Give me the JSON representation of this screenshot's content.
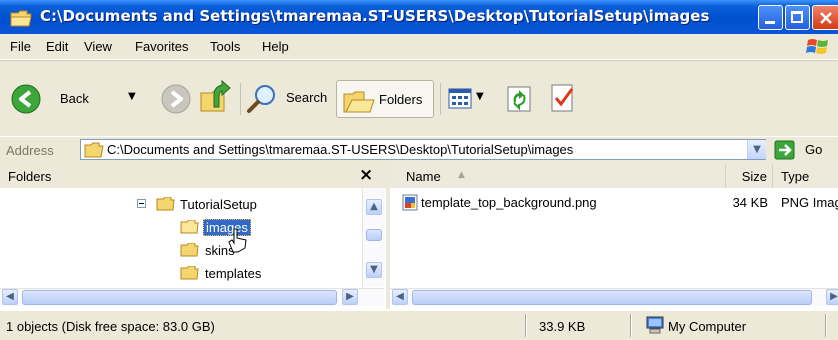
{
  "window": {
    "title": "C:\\Documents and Settings\\tmaremaa.ST-USERS\\Desktop\\TutorialSetup\\images"
  },
  "menu": {
    "items": [
      "File",
      "Edit",
      "View",
      "Favorites",
      "Tools",
      "Help"
    ]
  },
  "toolbar": {
    "back_label": "Back",
    "search_label": "Search",
    "folders_label": "Folders"
  },
  "address": {
    "label": "Address",
    "value": "C:\\Documents and Settings\\tmaremaa.ST-USERS\\Desktop\\TutorialSetup\\images",
    "go_label": "Go"
  },
  "folders_pane": {
    "header": "Folders",
    "close_glyph": "×",
    "tree": {
      "parent": "TutorialSetup",
      "children": [
        "images",
        "skins",
        "templates"
      ],
      "selected": "images"
    }
  },
  "file_list": {
    "columns": [
      "Name",
      "Size",
      "Type"
    ],
    "rows": [
      {
        "name": "template_top_background.png",
        "size": "34 KB",
        "type": "PNG Image"
      }
    ]
  },
  "statusbar": {
    "objects": "1 objects (Disk free space: 83.0 GB)",
    "size": "33.9 KB",
    "zone": "My Computer"
  },
  "colors": {
    "titlebar": "#0054e3",
    "selection": "#316ac5",
    "chrome": "#ece9d8",
    "close_button": "#e0481f"
  }
}
